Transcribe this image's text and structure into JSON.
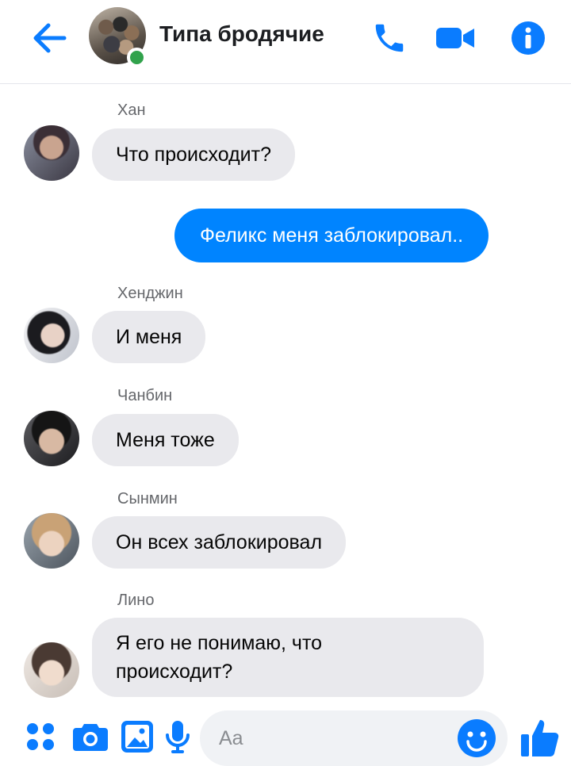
{
  "header": {
    "title": "Типа бродячие",
    "online": true
  },
  "messages": [
    {
      "sender": "Хан",
      "text": "Что происходит?",
      "direction": "incoming"
    },
    {
      "text": "Феликс меня заблокировал..",
      "direction": "outgoing"
    },
    {
      "sender": "Хенджин",
      "text": "И меня",
      "direction": "incoming"
    },
    {
      "sender": "Чанбин",
      "text": "Меня тоже",
      "direction": "incoming"
    },
    {
      "sender": "Сынмин",
      "text": "Он всех заблокировал",
      "direction": "incoming"
    },
    {
      "sender": "Лино",
      "text_line1": "Я его не понимаю, что",
      "text_line2": "происходит?",
      "direction": "incoming"
    }
  ],
  "composer": {
    "placeholder": "Aa"
  },
  "colors": {
    "accent": "#0084ff",
    "incoming_bubble": "#e9e9ed",
    "online": "#31a24c"
  },
  "icons": [
    "back-arrow-icon",
    "phone-icon",
    "video-camera-icon",
    "info-icon",
    "apps-grid-icon",
    "camera-icon",
    "image-icon",
    "microphone-icon",
    "emoji-icon",
    "thumbs-up-icon"
  ]
}
